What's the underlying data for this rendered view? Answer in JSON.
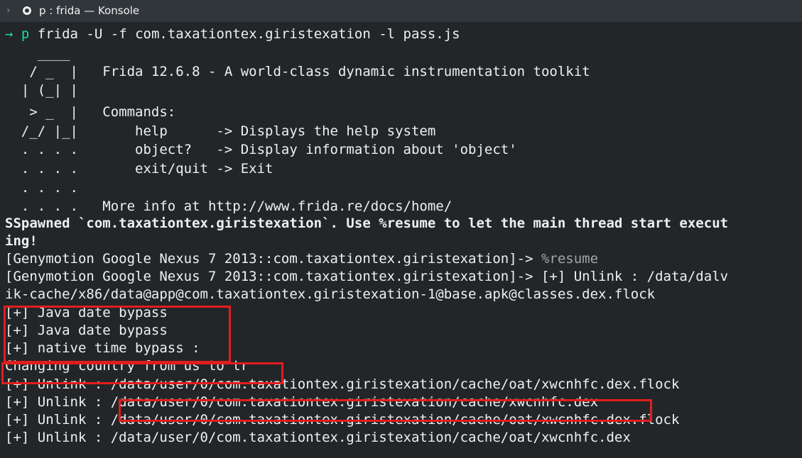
{
  "window": {
    "title": "p : frida — Konsole",
    "icons": {
      "menu": "chevron-right-icon",
      "app": "konsole-app-icon"
    }
  },
  "terminal": {
    "prompt_arrow": "→",
    "prompt_dir": "p",
    "command": " frida -U -f com.taxationtex.giristexation -l pass.js",
    "banner": [
      "    ____",
      "   / _  |   Frida 12.6.8 - A world-class dynamic instrumentation toolkit",
      "  | (_| |",
      "   > _  |   Commands:",
      "  /_/ |_|       help      -> Displays the help system",
      "  . . . .       object?   -> Display information about 'object'",
      "  . . . .       exit/quit -> Exit",
      "  . . . .",
      "  . . . .   More info at http://www.frida.re/docs/home/"
    ],
    "spawned": [
      "SSpawned `com.taxationtex.giristexation`. Use %resume to let the main thread start execut",
      "ing!"
    ],
    "resume_prompt": "[Genymotion Google Nexus 7 2013::com.taxationtex.giristexation]-> ",
    "resume_cmd": "%resume",
    "unlink_line": [
      "[Genymotion Google Nexus 7 2013::com.taxationtex.giristexation]-> [+] Unlink : /data/dalv",
      "ik-cache/x86/data@app@com.taxationtex.giristexation-1@base.apk@classes.dex.flock"
    ],
    "bypass": [
      "[+] Java date bypass",
      "[+] Java date bypass",
      "[+] native time bypass :"
    ],
    "country": "Changing country from us to tr",
    "unlinks": [
      "[+] Unlink : /data/user/0/com.taxationtex.giristexation/cache/oat/xwcnhfc.dex.flock",
      "[+] Unlink : /data/user/0/com.taxationtex.giristexation/cache/xwcnhfc.dex",
      "[+] Unlink : /data/user/0/com.taxationtex.giristexation/cache/oat/xwcnhfc.dex.flock",
      "[+] Unlink : /data/user/0/com.taxationtex.giristexation/cache/oat/xwcnhfc.dex"
    ]
  },
  "colors": {
    "background": "#232629",
    "text": "#eff0f1",
    "prompt": "#1cdc9a",
    "highlight": "#e31d1d"
  }
}
